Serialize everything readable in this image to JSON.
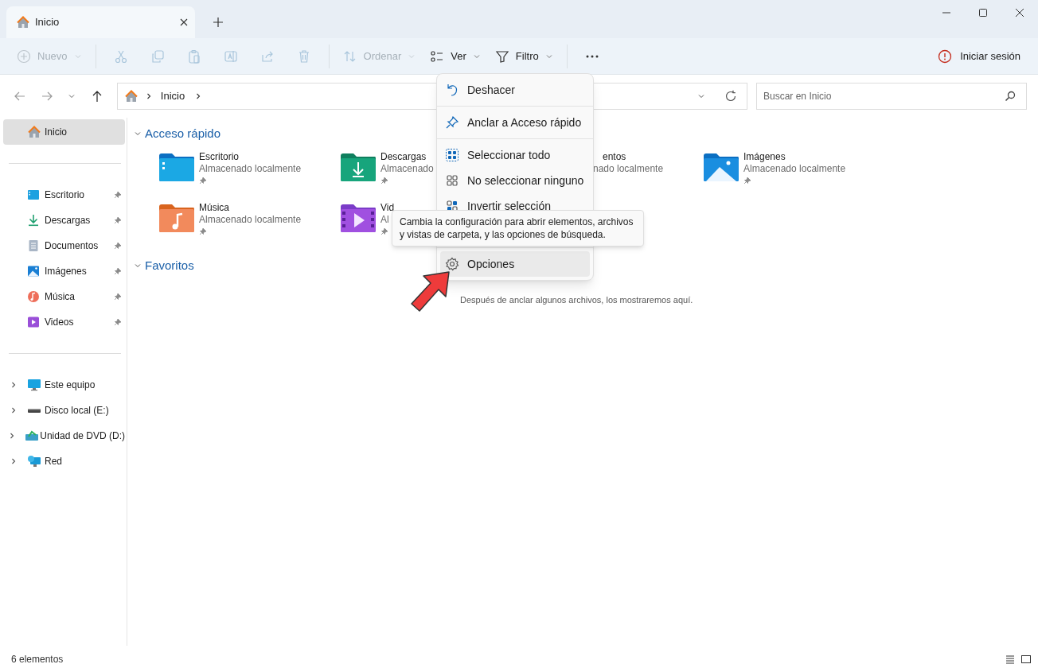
{
  "window": {
    "tab_title": "Inicio"
  },
  "toolbar": {
    "items": [
      {
        "kind": "new",
        "label": "Nuevo",
        "disabled": true,
        "dropdown": true
      },
      {
        "kind": "separator"
      },
      {
        "kind": "cut",
        "disabled": true
      },
      {
        "kind": "copy",
        "disabled": true
      },
      {
        "kind": "paste",
        "disabled": true
      },
      {
        "kind": "rename",
        "disabled": true
      },
      {
        "kind": "share",
        "disabled": true
      },
      {
        "kind": "delete",
        "disabled": true
      },
      {
        "kind": "separator"
      },
      {
        "kind": "sort",
        "label": "Ordenar",
        "disabled": true,
        "dropdown": true
      },
      {
        "kind": "view",
        "label": "Ver",
        "disabled": false,
        "dropdown": true
      },
      {
        "kind": "filter",
        "label": "Filtro",
        "disabled": false,
        "dropdown": true
      },
      {
        "kind": "separator"
      },
      {
        "kind": "more",
        "disabled": false
      }
    ],
    "sign_in": "Iniciar sesión"
  },
  "navigation": {
    "back_disabled": true,
    "forward_disabled": true
  },
  "address": {
    "crumbs": [
      "Inicio"
    ]
  },
  "search": {
    "placeholder": "Buscar en Inicio"
  },
  "sidebar": {
    "sections": [
      {
        "items": [
          {
            "kind": "home",
            "label": "Inicio",
            "selected": true
          }
        ]
      },
      {
        "items": [
          {
            "kind": "desktop",
            "label": "Escritorio",
            "pinned": true,
            "selected": false
          },
          {
            "kind": "downloads",
            "label": "Descargas",
            "pinned": true,
            "selected": false
          },
          {
            "kind": "documents",
            "label": "Documentos",
            "pinned": true,
            "selected": false
          },
          {
            "kind": "pictures",
            "label": "Imágenes",
            "pinned": true,
            "selected": false
          },
          {
            "kind": "music",
            "label": "Música",
            "pinned": true,
            "selected": false
          },
          {
            "kind": "videos",
            "label": "Videos",
            "pinned": true,
            "selected": false
          }
        ]
      },
      {
        "items": [
          {
            "kind": "pc",
            "label": "Este equipo",
            "expanded": false,
            "selected": false
          },
          {
            "kind": "disk",
            "label": "Disco local (E:)",
            "expanded": false,
            "selected": false
          },
          {
            "kind": "dvd",
            "label": "Unidad de DVD (D:)",
            "expanded": false,
            "selected": false
          },
          {
            "kind": "network",
            "label": "Red",
            "expanded": false,
            "selected": false
          }
        ]
      }
    ]
  },
  "sections": [
    {
      "title": "Acceso rápido",
      "expanded": true,
      "items": [
        {
          "kind": "desktop",
          "name": "Escritorio",
          "subtitle": "Almacenado localmente",
          "pinned": true
        },
        {
          "kind": "downloads",
          "name": "Descargas",
          "subtitle": "Almacenado",
          "pinned": true
        },
        {
          "kind": "covered",
          "name": "entos",
          "subtitle": "nado localmente"
        },
        {
          "kind": "pictures",
          "name": "Imágenes",
          "subtitle": "Almacenado localmente",
          "pinned": true
        },
        {
          "kind": "music",
          "name": "Música",
          "subtitle": "Almacenado localmente",
          "pinned": true
        },
        {
          "kind": "videos",
          "name": "Vid",
          "subtitle": "Al",
          "pinned": true
        }
      ]
    },
    {
      "title": "Favoritos",
      "expanded": true,
      "empty_text": "Después de anclar algunos archivos, los mostraremos aquí."
    }
  ],
  "context_menu": {
    "items": [
      {
        "kind": "undo",
        "label": "Deshacer",
        "selected": false
      },
      {
        "kind": "separator"
      },
      {
        "kind": "pin",
        "label": "Anclar a Acceso rápido",
        "selected": false
      },
      {
        "kind": "separator"
      },
      {
        "kind": "selectall",
        "label": "Seleccionar todo",
        "selected": false
      },
      {
        "kind": "selectnone",
        "label": "No seleccionar ninguno",
        "selected": false
      },
      {
        "kind": "invert",
        "label": "Invertir selección",
        "selected": false
      },
      {
        "kind": "hidden"
      },
      {
        "kind": "options",
        "label": "Opciones",
        "selected": true
      }
    ]
  },
  "tooltip": "Cambia la configuración para abrir elementos, archivos y vistas de carpeta, y las opciones de búsqueda.",
  "status_bar": {
    "count": "6 elementos"
  }
}
